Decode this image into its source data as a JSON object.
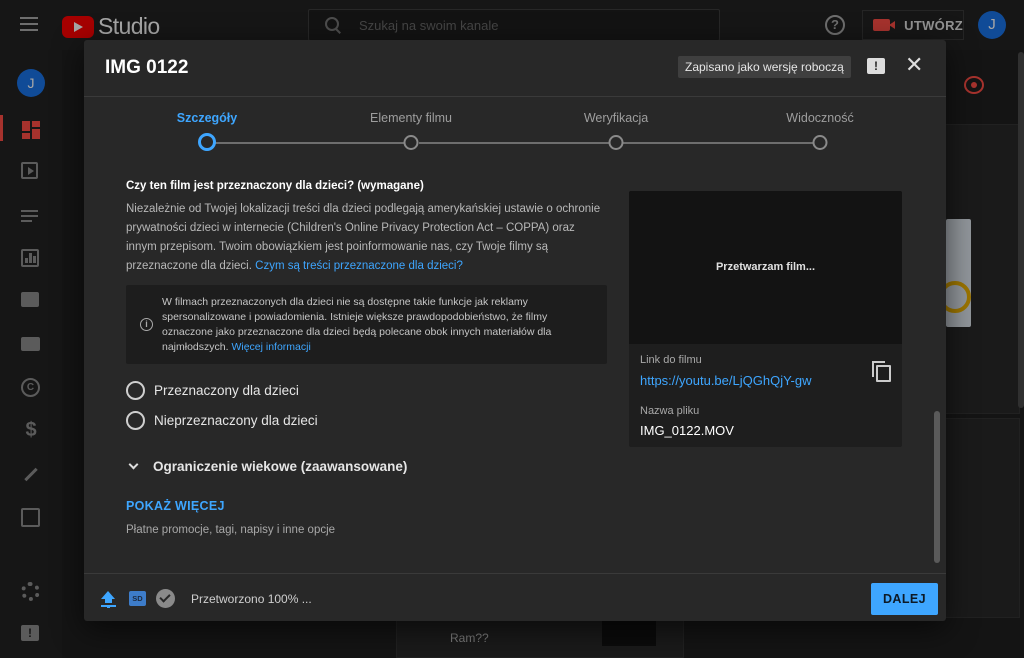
{
  "app": {
    "logo_text": "Studio",
    "search_placeholder": "Szukaj na swoim kanale",
    "create_label": "UTWÓRZ",
    "user_initial": "J"
  },
  "rail": {
    "user_initial": "J",
    "icons": [
      "dashboard-icon",
      "videos-icon",
      "playlists-icon",
      "analytics-icon",
      "comments-icon",
      "subtitles-icon",
      "copyright-icon",
      "monetization-icon",
      "customization-icon",
      "audio-library-icon",
      "settings-icon",
      "feedback-icon"
    ],
    "money_glyph": "$",
    "copyright_glyph": "C"
  },
  "background": {
    "footer_text": "Ram??"
  },
  "modal": {
    "title": "IMG 0122",
    "draft_badge": "Zapisano jako wersję roboczą",
    "steps": [
      {
        "label": "Szczegóły",
        "active": true
      },
      {
        "label": "Elementy filmu",
        "active": false
      },
      {
        "label": "Weryfikacja",
        "active": false
      },
      {
        "label": "Widoczność",
        "active": false
      }
    ],
    "audience": {
      "title": "Czy ten film jest przeznaczony dla dzieci? (wymagane)",
      "description": "Niezależnie od Twojej lokalizacji treści dla dzieci podlegają amerykańskiej ustawie o ochronie prywatności dzieci w internecie (Children's Online Privacy Protection Act – COPPA) oraz innym przepisom. Twoim obowiązkiem jest poinformowanie nas, czy Twoje filmy są przeznaczone dla dzieci.",
      "description_link": "Czym są treści przeznaczone dla dzieci?",
      "info_text": "W filmach przeznaczonych dla dzieci nie są dostępne takie funkcje jak reklamy spersonalizowane i powiadomienia. Istnieje większe prawdopodobieństwo, że filmy oznaczone jako przeznaczone dla dzieci będą polecane obok innych materiałów dla najmłodszych.",
      "info_link": "Więcej informacji",
      "options": [
        "Przeznaczony dla dzieci",
        "Nieprzeznaczony dla dzieci"
      ]
    },
    "age_restriction_label": "Ograniczenie wiekowe (zaawansowane)",
    "show_more": {
      "label": "POKAŻ WIĘCEJ",
      "subtitle": "Płatne promocje, tagi, napisy i inne opcje"
    },
    "preview": {
      "status": "Przetwarzam film...",
      "link_label": "Link do filmu",
      "link_url": "https://youtu.be/LjQGhQjY-gw",
      "filename_label": "Nazwa pliku",
      "filename": "IMG_0122.MOV"
    },
    "footer": {
      "sd_badge": "SD",
      "processed_text": "Przetworzono 100% ...",
      "next_label": "DALEJ"
    }
  },
  "colors": {
    "accent": "#3ea6ff",
    "brand": "#ff0000",
    "modal_bg": "#282828",
    "page_bg": "#1f1f1f"
  }
}
